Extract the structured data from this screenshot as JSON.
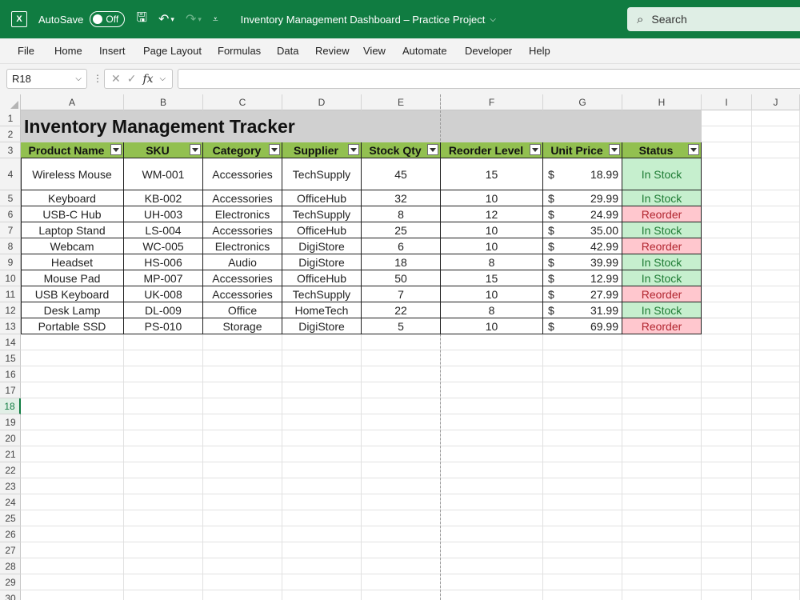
{
  "app": {
    "autosave_label": "AutoSave",
    "autosave_state": "Off",
    "document_title": "Inventory Management Dashboard – Practice Project",
    "search_label": "Search"
  },
  "menu": [
    "File",
    "Home",
    "Insert",
    "Page Layout",
    "Formulas",
    "Data",
    "Review",
    "View",
    "Automate",
    "Developer",
    "Help"
  ],
  "formula_bar": {
    "name_box": "R18",
    "fx_label": "fx",
    "formula": ""
  },
  "columns": [
    "A",
    "B",
    "C",
    "D",
    "E",
    "F",
    "G",
    "H",
    "I",
    "J"
  ],
  "rows": [
    "1",
    "2",
    "3",
    "4",
    "5",
    "6",
    "7",
    "8",
    "9",
    "10",
    "11",
    "12",
    "13",
    "14",
    "15",
    "16",
    "17",
    "18",
    "19",
    "20",
    "21",
    "22",
    "23",
    "24",
    "25",
    "26",
    "27",
    "28",
    "29",
    "30"
  ],
  "selected_row": "18",
  "sheet": {
    "title": "Inventory Management Tracker",
    "headers": [
      "Product Name",
      "SKU",
      "Category",
      "Supplier",
      "Stock Qty",
      "Reorder Level",
      "Unit Price",
      "Status"
    ],
    "currency_symbol": "$",
    "records": [
      [
        "Wireless Mouse",
        "WM-001",
        "Accessories",
        "TechSupply",
        "45",
        "15",
        "18.99",
        "In Stock"
      ],
      [
        "Keyboard",
        "KB-002",
        "Accessories",
        "OfficeHub",
        "32",
        "10",
        "29.99",
        "In Stock"
      ],
      [
        "USB-C Hub",
        "UH-003",
        "Electronics",
        "TechSupply",
        "8",
        "12",
        "24.99",
        "Reorder"
      ],
      [
        "Laptop Stand",
        "LS-004",
        "Accessories",
        "OfficeHub",
        "25",
        "10",
        "35.00",
        "In Stock"
      ],
      [
        "Webcam",
        "WC-005",
        "Electronics",
        "DigiStore",
        "6",
        "10",
        "42.99",
        "Reorder"
      ],
      [
        "Headset",
        "HS-006",
        "Audio",
        "DigiStore",
        "18",
        "8",
        "39.99",
        "In Stock"
      ],
      [
        "Mouse Pad",
        "MP-007",
        "Accessories",
        "OfficeHub",
        "50",
        "15",
        "12.99",
        "In Stock"
      ],
      [
        "USB Keyboard",
        "UK-008",
        "Accessories",
        "TechSupply",
        "7",
        "10",
        "27.99",
        "Reorder"
      ],
      [
        "Desk Lamp",
        "DL-009",
        "Office",
        "HomeTech",
        "22",
        "8",
        "31.99",
        "In Stock"
      ],
      [
        "Portable SSD",
        "PS-010",
        "Storage",
        "DigiStore",
        "5",
        "10",
        "69.99",
        "Reorder"
      ]
    ]
  },
  "colors": {
    "ribbon_green": "#107c41",
    "header_fill": "#92c050",
    "title_fill": "#d0d0d0",
    "in_stock_fill": "#c6efce",
    "in_stock_text": "#1e7b34",
    "reorder_fill": "#ffc7ce",
    "reorder_text": "#b1242e"
  }
}
